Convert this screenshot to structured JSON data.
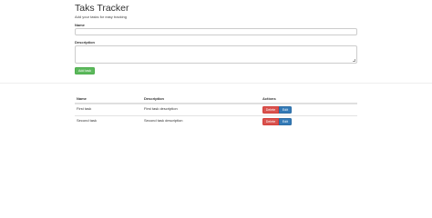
{
  "header": {
    "title": "Taks Tracker",
    "subtitle": "Add your tasks for easy tracking"
  },
  "form": {
    "name_label": "Name",
    "name_value": "",
    "description_label": "Description",
    "description_value": "",
    "add_button_label": "Add task"
  },
  "table": {
    "columns": [
      "Name",
      "Description",
      "Actions"
    ],
    "rows": [
      {
        "name": "First task",
        "description": "First task description",
        "delete_label": "Delete",
        "edit_label": "Edit"
      },
      {
        "name": "Second task",
        "description": "Second task description",
        "delete_label": "Delete",
        "edit_label": "Edit"
      }
    ]
  },
  "colors": {
    "add_button": "#5cb85c",
    "delete_button": "#d9534f",
    "edit_button": "#337ab7"
  }
}
